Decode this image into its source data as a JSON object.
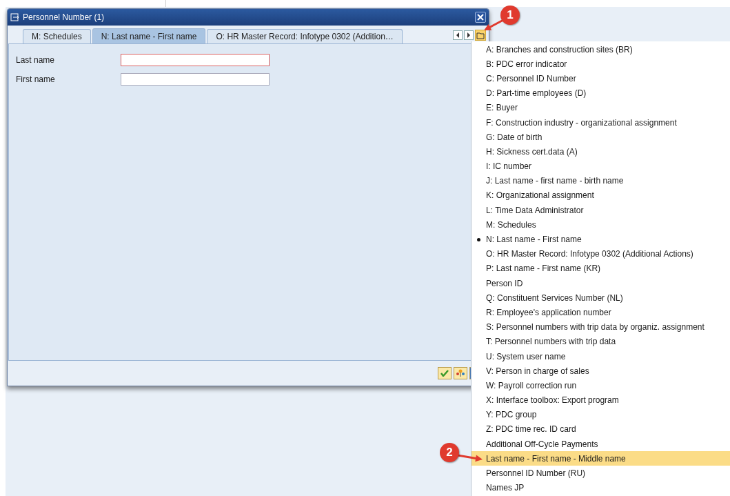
{
  "window": {
    "title": "Personnel Number (1)"
  },
  "tabs": [
    {
      "label": "M: Schedules",
      "selected": false
    },
    {
      "label": "N: Last name - First name",
      "selected": true
    },
    {
      "label": "O: HR Master Record: Infotype 0302 (Addition…",
      "selected": false
    }
  ],
  "fields": [
    {
      "label": "Last name",
      "focused": true
    },
    {
      "label": "First name",
      "focused": false
    }
  ],
  "menu": {
    "items": [
      {
        "label": "A: Branches and construction sites (BR)",
        "checked": false,
        "selected": false
      },
      {
        "label": "B: PDC error indicator",
        "checked": false,
        "selected": false
      },
      {
        "label": "C: Personnel ID Number",
        "checked": false,
        "selected": false
      },
      {
        "label": "D: Part-time employees (D)",
        "checked": false,
        "selected": false
      },
      {
        "label": "E: Buyer",
        "checked": false,
        "selected": false
      },
      {
        "label": "F: Construction industry - organizational assignment",
        "checked": false,
        "selected": false
      },
      {
        "label": "G: Date of birth",
        "checked": false,
        "selected": false
      },
      {
        "label": "H: Sickness cert.data (A)",
        "checked": false,
        "selected": false
      },
      {
        "label": "I: IC number",
        "checked": false,
        "selected": false
      },
      {
        "label": "J: Last name - first name - birth name",
        "checked": false,
        "selected": false
      },
      {
        "label": "K: Organizational assignment",
        "checked": false,
        "selected": false
      },
      {
        "label": "L: Time Data Administrator",
        "checked": false,
        "selected": false
      },
      {
        "label": "M: Schedules",
        "checked": false,
        "selected": false
      },
      {
        "label": "N: Last name - First name",
        "checked": true,
        "selected": false
      },
      {
        "label": "O: HR Master Record: Infotype 0302 (Additional Actions)",
        "checked": false,
        "selected": false
      },
      {
        "label": "P: Last name - First name (KR)",
        "checked": false,
        "selected": false
      },
      {
        "label": "Person ID",
        "checked": false,
        "selected": false
      },
      {
        "label": "Q: Constituent Services Number (NL)",
        "checked": false,
        "selected": false
      },
      {
        "label": "R: Employee's application number",
        "checked": false,
        "selected": false
      },
      {
        "label": "S: Personnel numbers with trip data by organiz. assignment",
        "checked": false,
        "selected": false
      },
      {
        "label": "T: Personnel numbers with trip data",
        "checked": false,
        "selected": false
      },
      {
        "label": "U: System user name",
        "checked": false,
        "selected": false
      },
      {
        "label": "V: Person in charge of sales",
        "checked": false,
        "selected": false
      },
      {
        "label": "W: Payroll correction run",
        "checked": false,
        "selected": false
      },
      {
        "label": "X: Interface toolbox: Export program",
        "checked": false,
        "selected": false
      },
      {
        "label": "Y: PDC group",
        "checked": false,
        "selected": false
      },
      {
        "label": "Z: PDC time rec. ID card",
        "checked": false,
        "selected": false
      },
      {
        "label": "Additional Off-Cycle Payments",
        "checked": false,
        "selected": false
      },
      {
        "label": "Last name - First name - Middle name",
        "checked": false,
        "selected": true
      },
      {
        "label": "Personnel ID Number (RU)",
        "checked": false,
        "selected": false
      },
      {
        "label": "Names JP",
        "checked": false,
        "selected": false
      }
    ]
  },
  "annotations": [
    {
      "label": "1"
    },
    {
      "label": "2"
    }
  ]
}
